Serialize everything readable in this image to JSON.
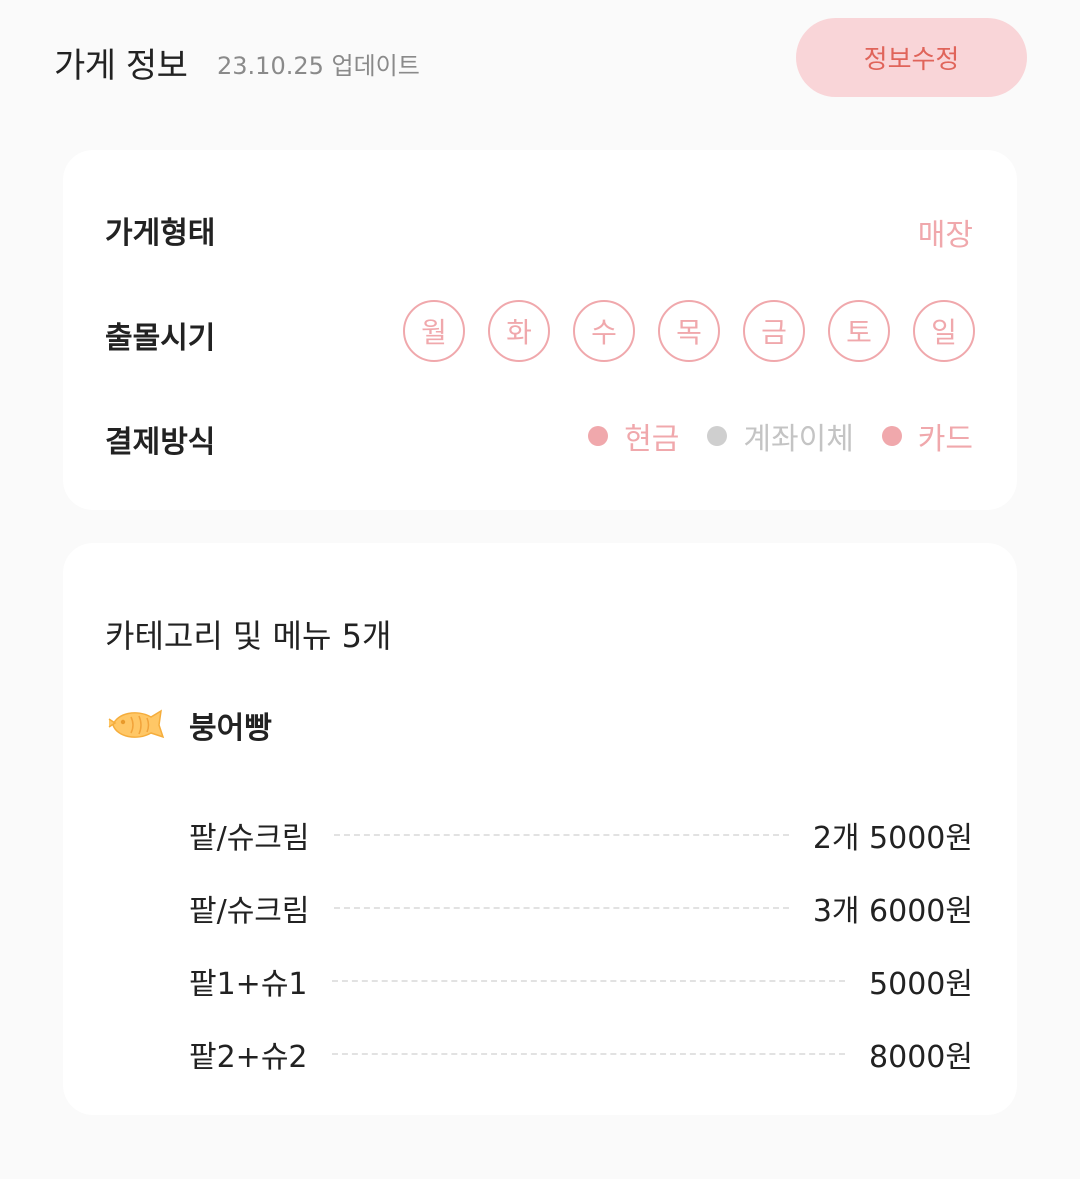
{
  "header": {
    "title": "가게 정보",
    "updated": "23.10.25 업데이트",
    "edit_label": "정보수정"
  },
  "info": {
    "store_type_label": "가게형태",
    "store_type_value": "매장",
    "days_label": "출몰시기",
    "days": [
      "월",
      "화",
      "수",
      "목",
      "금",
      "토",
      "일"
    ],
    "payment_label": "결제방식",
    "payments": [
      {
        "label": "현금",
        "active": true
      },
      {
        "label": "계좌이체",
        "active": false
      },
      {
        "label": "카드",
        "active": true
      }
    ]
  },
  "menu": {
    "title": "카테고리 및 메뉴 5개",
    "category": {
      "icon": "bungeoppang-icon",
      "name": "붕어빵"
    },
    "items": [
      {
        "name": "팥/슈크림",
        "price": "2개 5000원"
      },
      {
        "name": "팥/슈크림",
        "price": "3개 6000원"
      },
      {
        "name": "팥1+슈1",
        "price": "5000원"
      },
      {
        "name": "팥2+슈2",
        "price": "8000원"
      }
    ]
  },
  "colors": {
    "accent": "#f0a8ac",
    "button_bg": "#f9d5d8",
    "button_text": "#e0645a",
    "inactive": "#c4c4c4"
  }
}
